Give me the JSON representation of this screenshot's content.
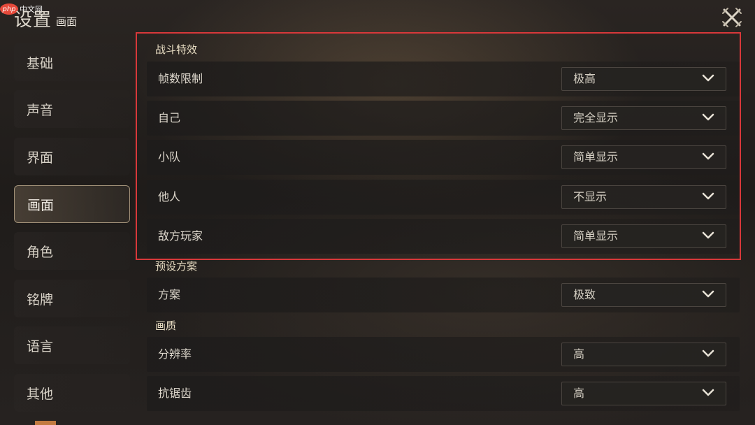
{
  "watermark": {
    "logo": "php",
    "text": "中文网"
  },
  "header": {
    "title": "设置",
    "subtitle": "画面"
  },
  "sidebar": {
    "items": [
      {
        "label": "基础"
      },
      {
        "label": "声音"
      },
      {
        "label": "界面"
      },
      {
        "label": "画面",
        "active": true
      },
      {
        "label": "角色"
      },
      {
        "label": "铭牌"
      },
      {
        "label": "语言"
      },
      {
        "label": "其他"
      }
    ]
  },
  "sections": {
    "battle": {
      "title": "战斗特效",
      "rows": [
        {
          "label": "帧数限制",
          "value": "极高"
        },
        {
          "label": "自己",
          "value": "完全显示"
        },
        {
          "label": "小队",
          "value": "简单显示"
        },
        {
          "label": "他人",
          "value": "不显示"
        },
        {
          "label": "敌方玩家",
          "value": "简单显示"
        }
      ]
    },
    "preset": {
      "title": "预设方案",
      "rows": [
        {
          "label": "方案",
          "value": "极致"
        }
      ]
    },
    "quality": {
      "title": "画质",
      "rows": [
        {
          "label": "分辨率",
          "value": "高"
        },
        {
          "label": "抗锯齿",
          "value": "高"
        }
      ]
    }
  },
  "icons": {
    "close": "close-icon",
    "dropdown": "chevron-down-icon"
  },
  "colors": {
    "highlight": "#d8383a",
    "section_title": "#e7dcc2"
  }
}
